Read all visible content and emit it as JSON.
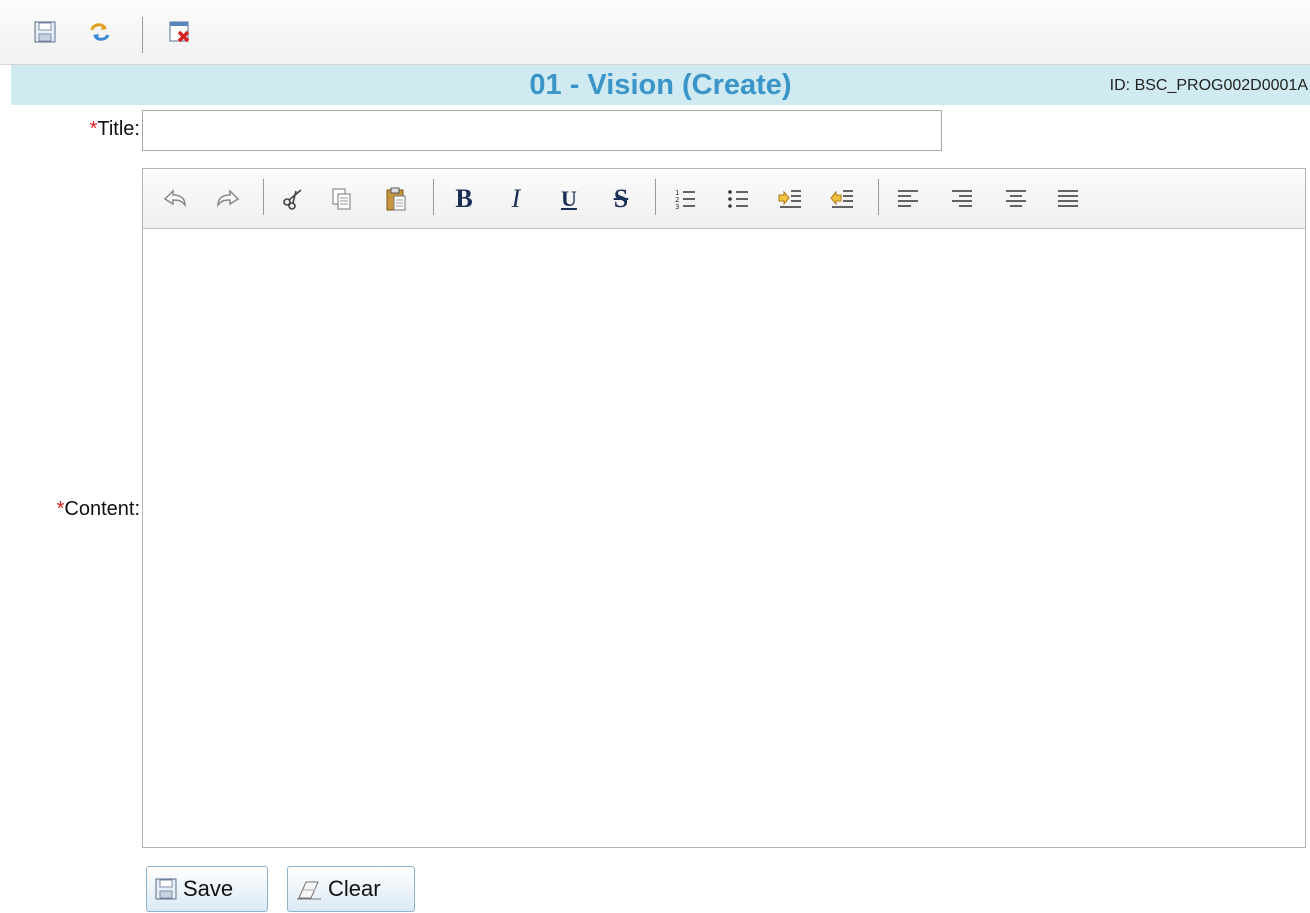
{
  "toolbar": {
    "icons": [
      "save-icon",
      "refresh-icon",
      "close-window-icon"
    ]
  },
  "header": {
    "title": "01 - Vision (Create)",
    "id_text": "ID: BSC_PROG002D0001A"
  },
  "form": {
    "title_required_mark": "*",
    "title_label": "Title:",
    "title_value": "",
    "content_required_mark": "*",
    "content_label": "Content:"
  },
  "editor": {
    "tools": [
      "undo-icon",
      "redo-icon",
      "cut-icon",
      "copy-icon",
      "paste-icon",
      "bold-icon",
      "italic-icon",
      "underline-icon",
      "strikethrough-icon",
      "ordered-list-icon",
      "unordered-list-icon",
      "indent-icon",
      "outdent-icon",
      "align-left-icon",
      "align-right-icon",
      "align-center-icon",
      "justify-icon"
    ],
    "bold_glyph": "B",
    "italic_glyph": "I",
    "underline_glyph": "U",
    "strike_glyph": "S"
  },
  "buttons": {
    "save_label": "Save",
    "clear_label": "Clear"
  },
  "colors": {
    "title_color": "#3b95c8",
    "header_bg": "#cfeaf0",
    "required_mark": "#e02020"
  }
}
